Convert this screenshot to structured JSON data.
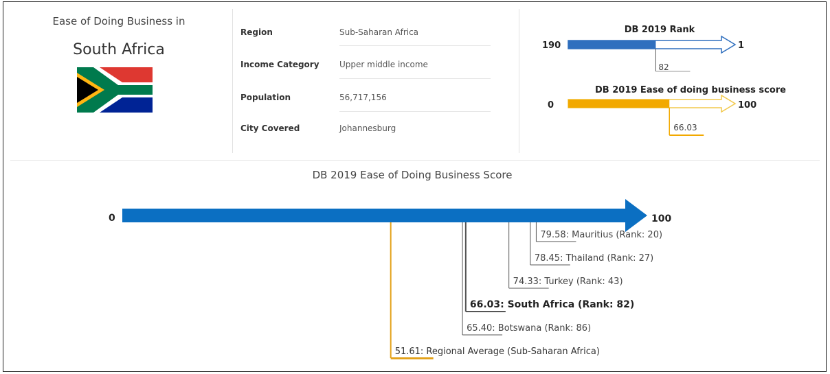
{
  "header": {
    "title_small": "Ease of Doing Business in",
    "country": "South Africa"
  },
  "info": [
    {
      "label": "Region",
      "value": "Sub-Saharan Africa"
    },
    {
      "label": "Income Category",
      "value": "Upper middle income"
    },
    {
      "label": "Population",
      "value": "56,717,156"
    },
    {
      "label": "City Covered",
      "value": "Johannesburg"
    }
  ],
  "rank_gauge": {
    "title": "DB 2019 Rank",
    "min_label": "190",
    "max_label": "1",
    "value": 82,
    "value_label": "82",
    "color": "#2f6fbe"
  },
  "score_gauge": {
    "title": "DB 2019 Ease of doing business score",
    "min_label": "0",
    "max_label": "100",
    "value": 66.03,
    "value_label": "66.03",
    "color": "#f2a900"
  },
  "chart_data": {
    "type": "bar",
    "title": "DB 2019 Ease of Doing Business Score",
    "xlim": [
      0,
      100
    ],
    "min_label": "0",
    "max_label": "100",
    "arrow_color": "#0b6fc2",
    "economies": [
      {
        "label": "79.58: Mauritius (Rank: 20)",
        "value": 79.58,
        "bold": false,
        "color": "#444444"
      },
      {
        "label": "78.45: Thailand (Rank: 27)",
        "value": 78.45,
        "bold": false,
        "color": "#444444"
      },
      {
        "label": "74.33: Turkey (Rank: 43)",
        "value": 74.33,
        "bold": false,
        "color": "#444444"
      },
      {
        "label": "66.03: South Africa (Rank: 82)",
        "value": 66.03,
        "bold": true,
        "color": "#222222"
      },
      {
        "label": "65.40: Botswana (Rank: 86)",
        "value": 65.4,
        "bold": false,
        "color": "#444444"
      },
      {
        "label": "51.61: Regional Average (Sub-Saharan Africa)",
        "value": 51.61,
        "bold": false,
        "color": "#e3a21a"
      }
    ]
  }
}
